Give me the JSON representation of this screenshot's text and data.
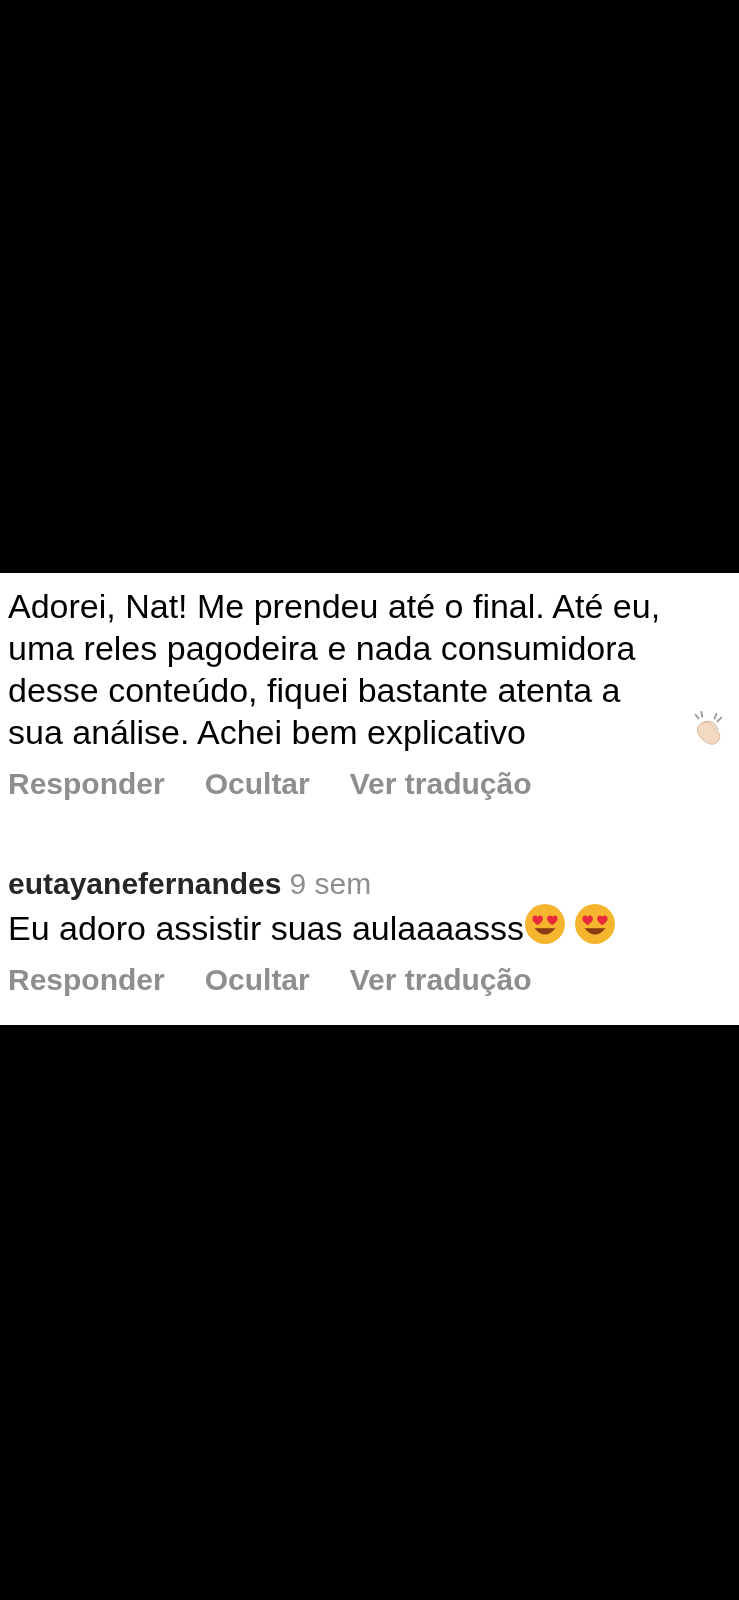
{
  "comments": [
    {
      "text": "Adorei, Nat! Me prendeu até o final. Até eu, uma reles pagodeira e nada consumidora desse conteúdo, fiquei bastante atenta a sua análise. Achei bem explicativo",
      "icons": [
        {
          "kind": "clap"
        }
      ],
      "actions": [
        "Responder",
        "Ocultar",
        "Ver tradução"
      ]
    },
    {
      "username": "eutayanefernandes",
      "time": "9 sem",
      "text": "Eu adoro assistir suas aulaaaasss",
      "icons": [
        {
          "kind": "heart_eyes"
        },
        {
          "kind": "heart_eyes"
        }
      ],
      "actions": [
        "Responder",
        "Ocultar",
        "Ver tradução"
      ]
    }
  ]
}
